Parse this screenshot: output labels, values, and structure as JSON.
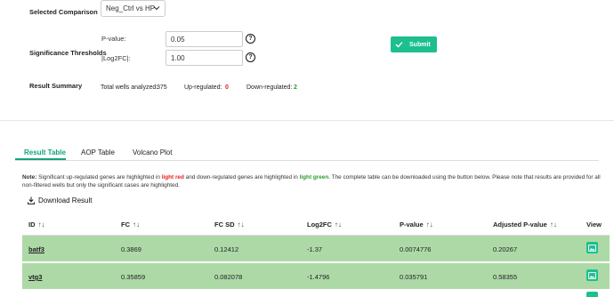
{
  "controls": {
    "comparison_label": "Selected Comparison",
    "comparison_value": "Neg_Ctrl vs HP",
    "thresholds_label": "Significance Thresholds",
    "pvalue_label": "P-value:",
    "pvalue_value": "0.05",
    "log2fc_label": "|Log2FC|:",
    "log2fc_value": "1.00",
    "help_glyph": "?",
    "submit_label": "Submit"
  },
  "summary": {
    "label": "Result Summary",
    "total_label": "Total wells analyzed:",
    "total_value": "375",
    "up_label": "Up-regulated:",
    "up_value": "0",
    "down_label": "Down-regulated:",
    "down_value": "2"
  },
  "tabs": [
    {
      "label": "Result Table",
      "active": true
    },
    {
      "label": "AOP Table",
      "active": false
    },
    {
      "label": "Volcano Plot",
      "active": false
    }
  ],
  "note": {
    "prefix": "Note:",
    "part1": " Significant up-regulated genes are highlighted in ",
    "light_red": "light red",
    "part2": " and down-regulated genes are highlighted in ",
    "light_green": "light green",
    "part3": ". The complete table can be downloaded using the button below. Please note that results are provided for all non-filtered wells but only the significant cases are highlighted."
  },
  "download_label": "Download Result",
  "table": {
    "headers": [
      "ID",
      "FC",
      "FC SD",
      "Log2FC",
      "P-value",
      "Adjusted P-value",
      "View"
    ],
    "sort_glyph": "↑↓",
    "rows": [
      {
        "id": "batf3",
        "fc": "0.3869",
        "fc_sd": "0.12412",
        "log2fc": "-1.37",
        "pvalue": "0.0074776",
        "adj_pvalue": "0.20267"
      },
      {
        "id": "vtg3",
        "fc": "0.35859",
        "fc_sd": "0.082078",
        "log2fc": "-1.4796",
        "pvalue": "0.035791",
        "adj_pvalue": "0.58355"
      }
    ],
    "highlight_color": "#add9a7"
  },
  "colors": {
    "accent": "#1dbf8f",
    "up": "#e02020",
    "down": "#2e9b2e"
  }
}
